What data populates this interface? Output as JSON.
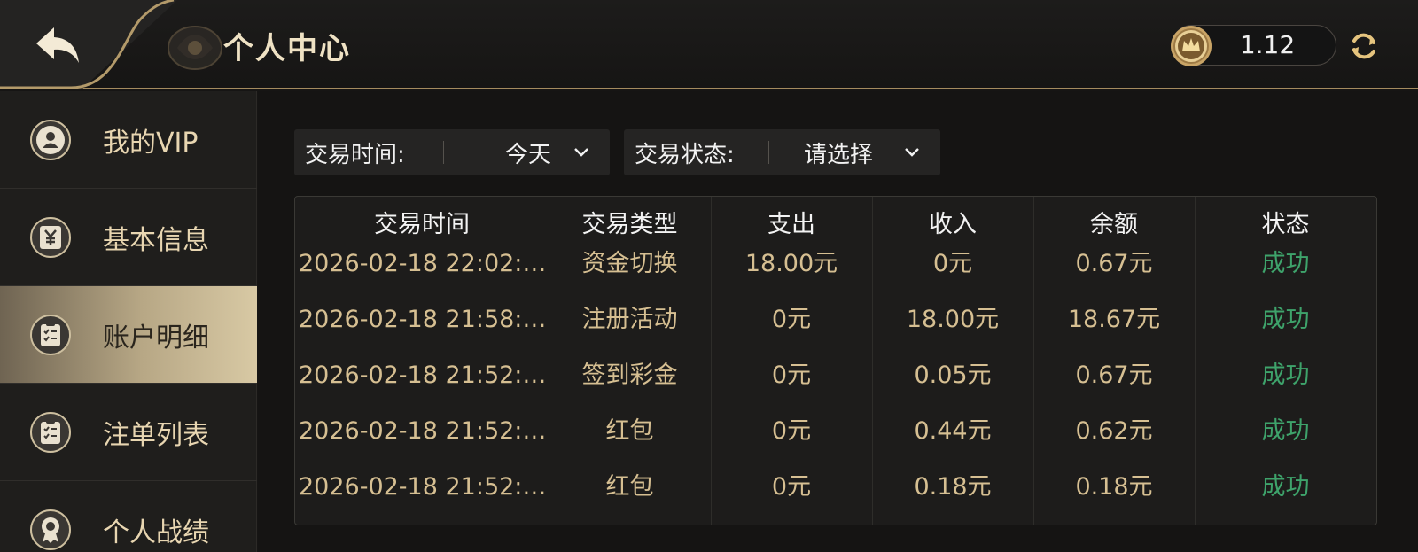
{
  "header": {
    "title": "个人中心",
    "balance": "1.12",
    "back_icon": "back-arrow-icon",
    "coin_icon": "crown-coin-icon",
    "refresh_icon": "refresh-icon"
  },
  "colors": {
    "gold": "#a48b5e",
    "gold_text": "#d6bf92",
    "success": "#3ea36b",
    "active_tab": "#b7a785"
  },
  "sidebar": {
    "items": [
      {
        "label": "我的VIP",
        "icon": "user-icon",
        "active": false
      },
      {
        "label": "基本信息",
        "icon": "yuan-icon",
        "active": false
      },
      {
        "label": "账户明细",
        "icon": "ledger-icon",
        "active": true
      },
      {
        "label": "注单列表",
        "icon": "ledger-icon",
        "active": false
      },
      {
        "label": "个人战绩",
        "icon": "medal-icon",
        "active": false
      }
    ]
  },
  "filters": {
    "time_label": "交易时间:",
    "time_value": "今天",
    "status_label": "交易状态:",
    "status_value": "请选择"
  },
  "table": {
    "headers": [
      "交易时间",
      "交易类型",
      "支出",
      "收入",
      "余额",
      "状态"
    ],
    "rows": [
      [
        "2026-02-18 22:02:…",
        "资金切换",
        "18.00元",
        "0元",
        "0.67元",
        "成功"
      ],
      [
        "2026-02-18 21:58:…",
        "注册活动",
        "0元",
        "18.00元",
        "18.67元",
        "成功"
      ],
      [
        "2026-02-18 21:52:…",
        "签到彩金",
        "0元",
        "0.05元",
        "0.67元",
        "成功"
      ],
      [
        "2026-02-18 21:52:…",
        "红包",
        "0元",
        "0.44元",
        "0.62元",
        "成功"
      ],
      [
        "2026-02-18 21:52:…",
        "红包",
        "0元",
        "0.18元",
        "0.18元",
        "成功"
      ]
    ]
  }
}
